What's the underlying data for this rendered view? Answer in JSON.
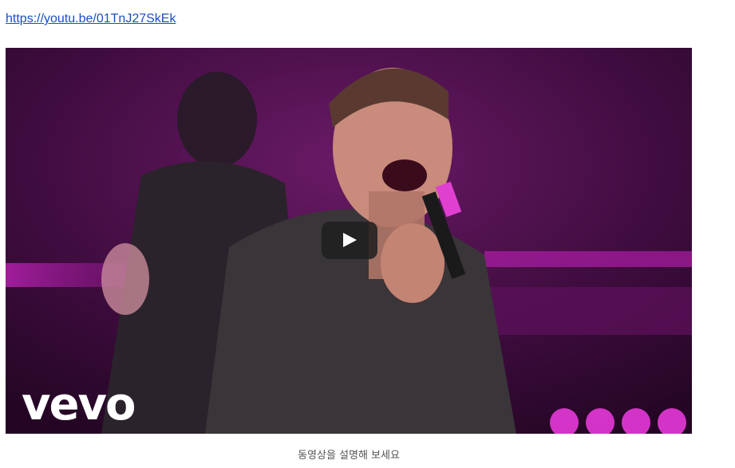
{
  "post": {
    "link_text": "https://youtu.be/01TnJ27SkEk",
    "caption": "동영상을 설명해 보세요"
  },
  "video": {
    "logo_text": "vevo",
    "play_icon": "play-icon",
    "colors": {
      "stage_bg": "#3a0b3a",
      "stage_glow": "#d31fd3",
      "play_button": "#1e1e1e"
    }
  }
}
